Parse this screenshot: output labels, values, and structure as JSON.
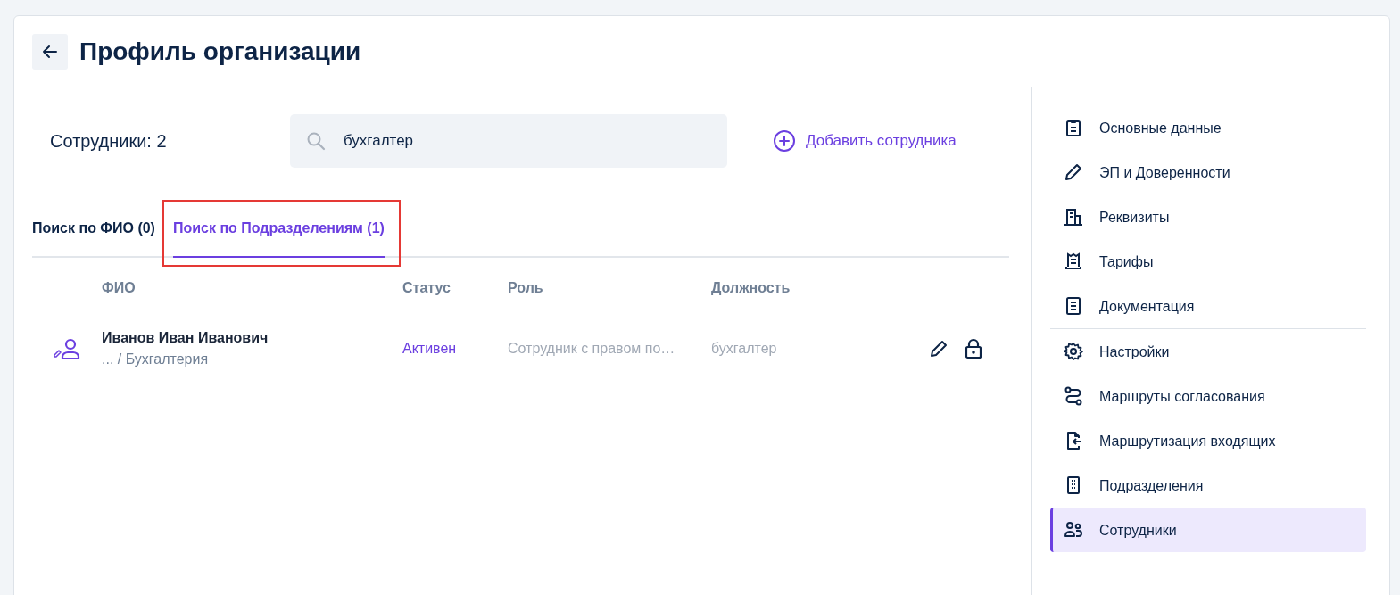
{
  "header": {
    "title": "Профиль организации"
  },
  "employees": {
    "count_label": "Сотрудники: 2",
    "search": {
      "value": "бухгалтер"
    },
    "add_button": "Добавить сотрудника"
  },
  "tabs": [
    {
      "label": "Поиск по ФИО (0)",
      "selected": false,
      "highlighted": false
    },
    {
      "label": "Поиск по Подразделениям (1)",
      "selected": true,
      "highlighted": true
    }
  ],
  "table": {
    "columns": [
      "ФИО",
      "Статус",
      "Роль",
      "Должность"
    ],
    "rows": [
      {
        "name": "Иванов Иван Иванович",
        "department": "... / Бухгалтерия",
        "status": "Активен",
        "role": "Сотрудник с правом по…",
        "position": "бухгалтер"
      }
    ]
  },
  "sidebar": {
    "sections": [
      [
        {
          "label": "Основные данные",
          "selected": false
        },
        {
          "label": "ЭП и Доверенности",
          "selected": false
        },
        {
          "label": "Реквизиты",
          "selected": false
        },
        {
          "label": "Тарифы",
          "selected": false
        },
        {
          "label": "Документация",
          "selected": false
        }
      ],
      [
        {
          "label": "Настройки",
          "selected": false
        },
        {
          "label": "Маршруты согласования",
          "selected": false
        },
        {
          "label": "Маршрутизация входящих",
          "selected": false
        },
        {
          "label": "Подразделения",
          "selected": false
        },
        {
          "label": "Сотрудники",
          "selected": true
        }
      ]
    ]
  }
}
